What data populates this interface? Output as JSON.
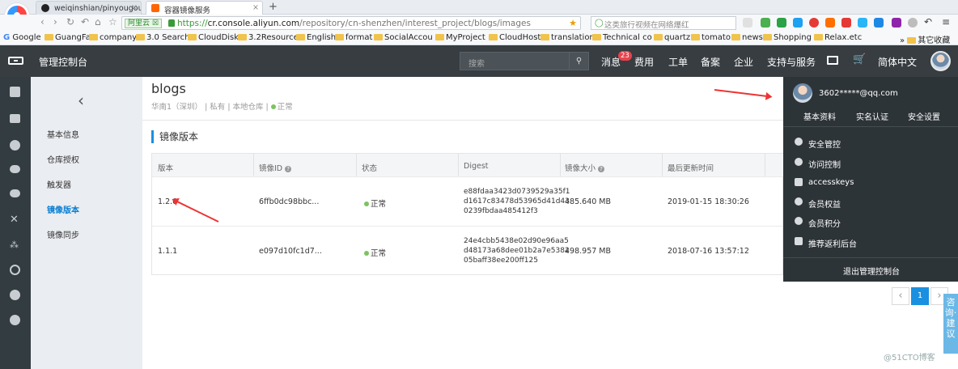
{
  "browser": {
    "tabs": [
      {
        "label": "weiqinshian/pinyougou"
      },
      {
        "label": "容器镜像服务"
      }
    ],
    "address": {
      "site_badge": "阿里云 ☒",
      "url_prefix": "https://",
      "url_domain": "cr.console.aliyun.com",
      "url_path": "/repository/cn-shenzhen/interest_project/blogs/images"
    },
    "search_placeholder": "这类旅行视频在网络爆红",
    "bookmarks": [
      "Google",
      "GuangFa",
      "company",
      "3.0 Search",
      "CloudDisk",
      "3.2Resource",
      "English",
      "format",
      "SocialAccou",
      "MyProject",
      "CloudHost",
      "translation",
      "Technical co",
      "quartz",
      "tomato",
      "news",
      "Shopping",
      "Relax.etc"
    ],
    "other_bookmarks": "其它收藏"
  },
  "topbar": {
    "title": "管理控制台",
    "search_placeholder": "搜索",
    "messages": "消息",
    "badge": "23",
    "items": [
      "费用",
      "工单",
      "备案",
      "企业",
      "支持与服务"
    ],
    "lang": "简体中文"
  },
  "sidebar": {
    "items": [
      "基本信息",
      "仓库授权",
      "触发器",
      "镜像版本",
      "镜像同步"
    ],
    "active": "镜像版本"
  },
  "repo": {
    "name": "blogs",
    "meta_region": "华南1（深圳）",
    "meta_rest": "| 私有 | 本地仓库 |",
    "status": "正常"
  },
  "section_title": "镜像版本",
  "table": {
    "headers": [
      "版本",
      "镜像ID",
      "状态",
      "Digest",
      "镜像大小",
      "最后更新时间"
    ],
    "rows": [
      {
        "version": "1.2.0",
        "image_id": "6ffb0dc98bbc...",
        "status": "正常",
        "digest": [
          "e88fdaa3423d0739529a35f1",
          "d1617c83478d53965d41d43",
          "0239fbdaa485412f3"
        ],
        "size": "485.640 MB",
        "updated": "2019-01-15 18:30:26"
      },
      {
        "version": "1.1.1",
        "image_id": "e097d10fc1d7...",
        "status": "正常",
        "digest": [
          "24e4cbb5438e02d90e96aa5",
          "d48173a68dee01b2a7e5382",
          "05baff38ee200ff125"
        ],
        "size": "498.957 MB",
        "updated": "2018-07-16 13:57:12"
      }
    ]
  },
  "account_menu": {
    "email": "3602*****@qq.com",
    "links": [
      "基本资料",
      "实名认证",
      "安全设置"
    ],
    "items": [
      "安全管控",
      "访问控制",
      "accesskeys",
      "会员权益",
      "会员积分",
      "推荐返利后台"
    ],
    "logout": "退出管理控制台"
  },
  "pagination": {
    "current": "1",
    "prev": "‹",
    "next": "›"
  },
  "consult": "咨询·建议",
  "watermark": "@51CTO博客"
}
